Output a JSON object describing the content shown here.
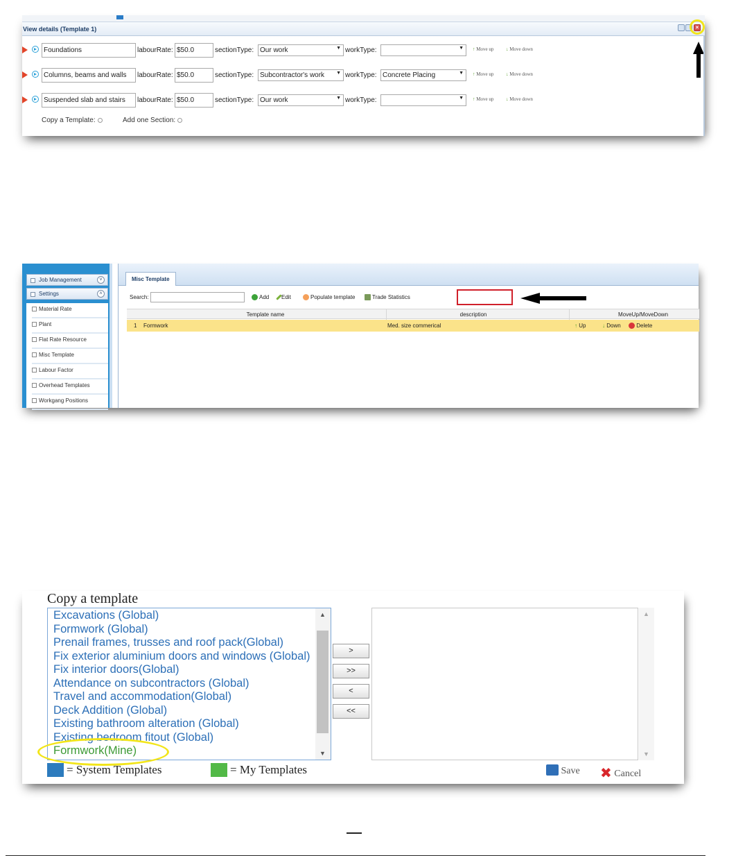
{
  "shot1": {
    "title": "View details (Template 1)",
    "labels": {
      "labour_rate": "labourRate:",
      "section_type": "sectionType:",
      "work_type": "workType:",
      "move_up": "Move up",
      "move_down": "Move down"
    },
    "rows": [
      {
        "name": "Foundations",
        "labour_rate": "$50.0",
        "section_type": "Our work",
        "work_type": ""
      },
      {
        "name": "Columns, beams  and walls",
        "labour_rate": "$50.0",
        "section_type": "Subcontractor's work",
        "work_type": "Concrete Placing"
      },
      {
        "name": "Suspended slab and stairs",
        "labour_rate": "$50.0",
        "section_type": "Our work",
        "work_type": ""
      }
    ],
    "copy_template_label": "Copy a Template:",
    "add_section_label": "Add one Section:"
  },
  "shot2": {
    "nav": {
      "sections": [
        "Job Management",
        "Settings"
      ],
      "items": [
        "Material Rate",
        "Plant",
        "Flat Rate Resource",
        "Misc Template",
        "Labour Factor",
        "Overhead Templates",
        "Workgang Positions"
      ]
    },
    "tab": "Misc Template",
    "search_label": "Search:",
    "toolbar": {
      "add": "Add",
      "edit": "Edit",
      "populate": "Populate template",
      "trade_stats": "Trade Statistics"
    },
    "columns": [
      "Template name",
      "description",
      "MoveUp/MoveDown"
    ],
    "rows": [
      {
        "num": "1",
        "name": "Formwork",
        "description": "Med. size commerical",
        "up": "Up",
        "down": "Down",
        "delete": "Delete"
      }
    ]
  },
  "shot3": {
    "title": "Copy a template",
    "templates": [
      {
        "label": "Excavations (Global)",
        "kind": "system"
      },
      {
        "label": "Formwork (Global)",
        "kind": "system"
      },
      {
        "label": "Prenail frames, trusses and roof pack(Global)",
        "kind": "system"
      },
      {
        "label": "Fix exterior aluminium doors and windows (Global)",
        "kind": "system"
      },
      {
        "label": "Fix interior doors(Global)",
        "kind": "system"
      },
      {
        "label": "Attendance on subcontractors (Global)",
        "kind": "system"
      },
      {
        "label": "Travel and accommodation(Global)",
        "kind": "system"
      },
      {
        "label": "Deck Addition (Global)",
        "kind": "system"
      },
      {
        "label": "Existing bathroom alteration (Global)",
        "kind": "system"
      },
      {
        "label": "Existing bedroom fitout (Global)",
        "kind": "system"
      },
      {
        "label": "Formwork(Mine)",
        "kind": "mine"
      }
    ],
    "buttons": [
      ">",
      ">>",
      "<",
      "<<"
    ],
    "legend": {
      "system": "= System Templates",
      "mine": "= My Templates"
    },
    "save": "Save",
    "cancel": "Cancel"
  },
  "colors": {
    "system_template": "#2c7bbd",
    "my_template": "#52b947",
    "highlight_row": "#fbe38a",
    "callout_box": "#d0202a",
    "callout_ring": "#f2e51a"
  }
}
